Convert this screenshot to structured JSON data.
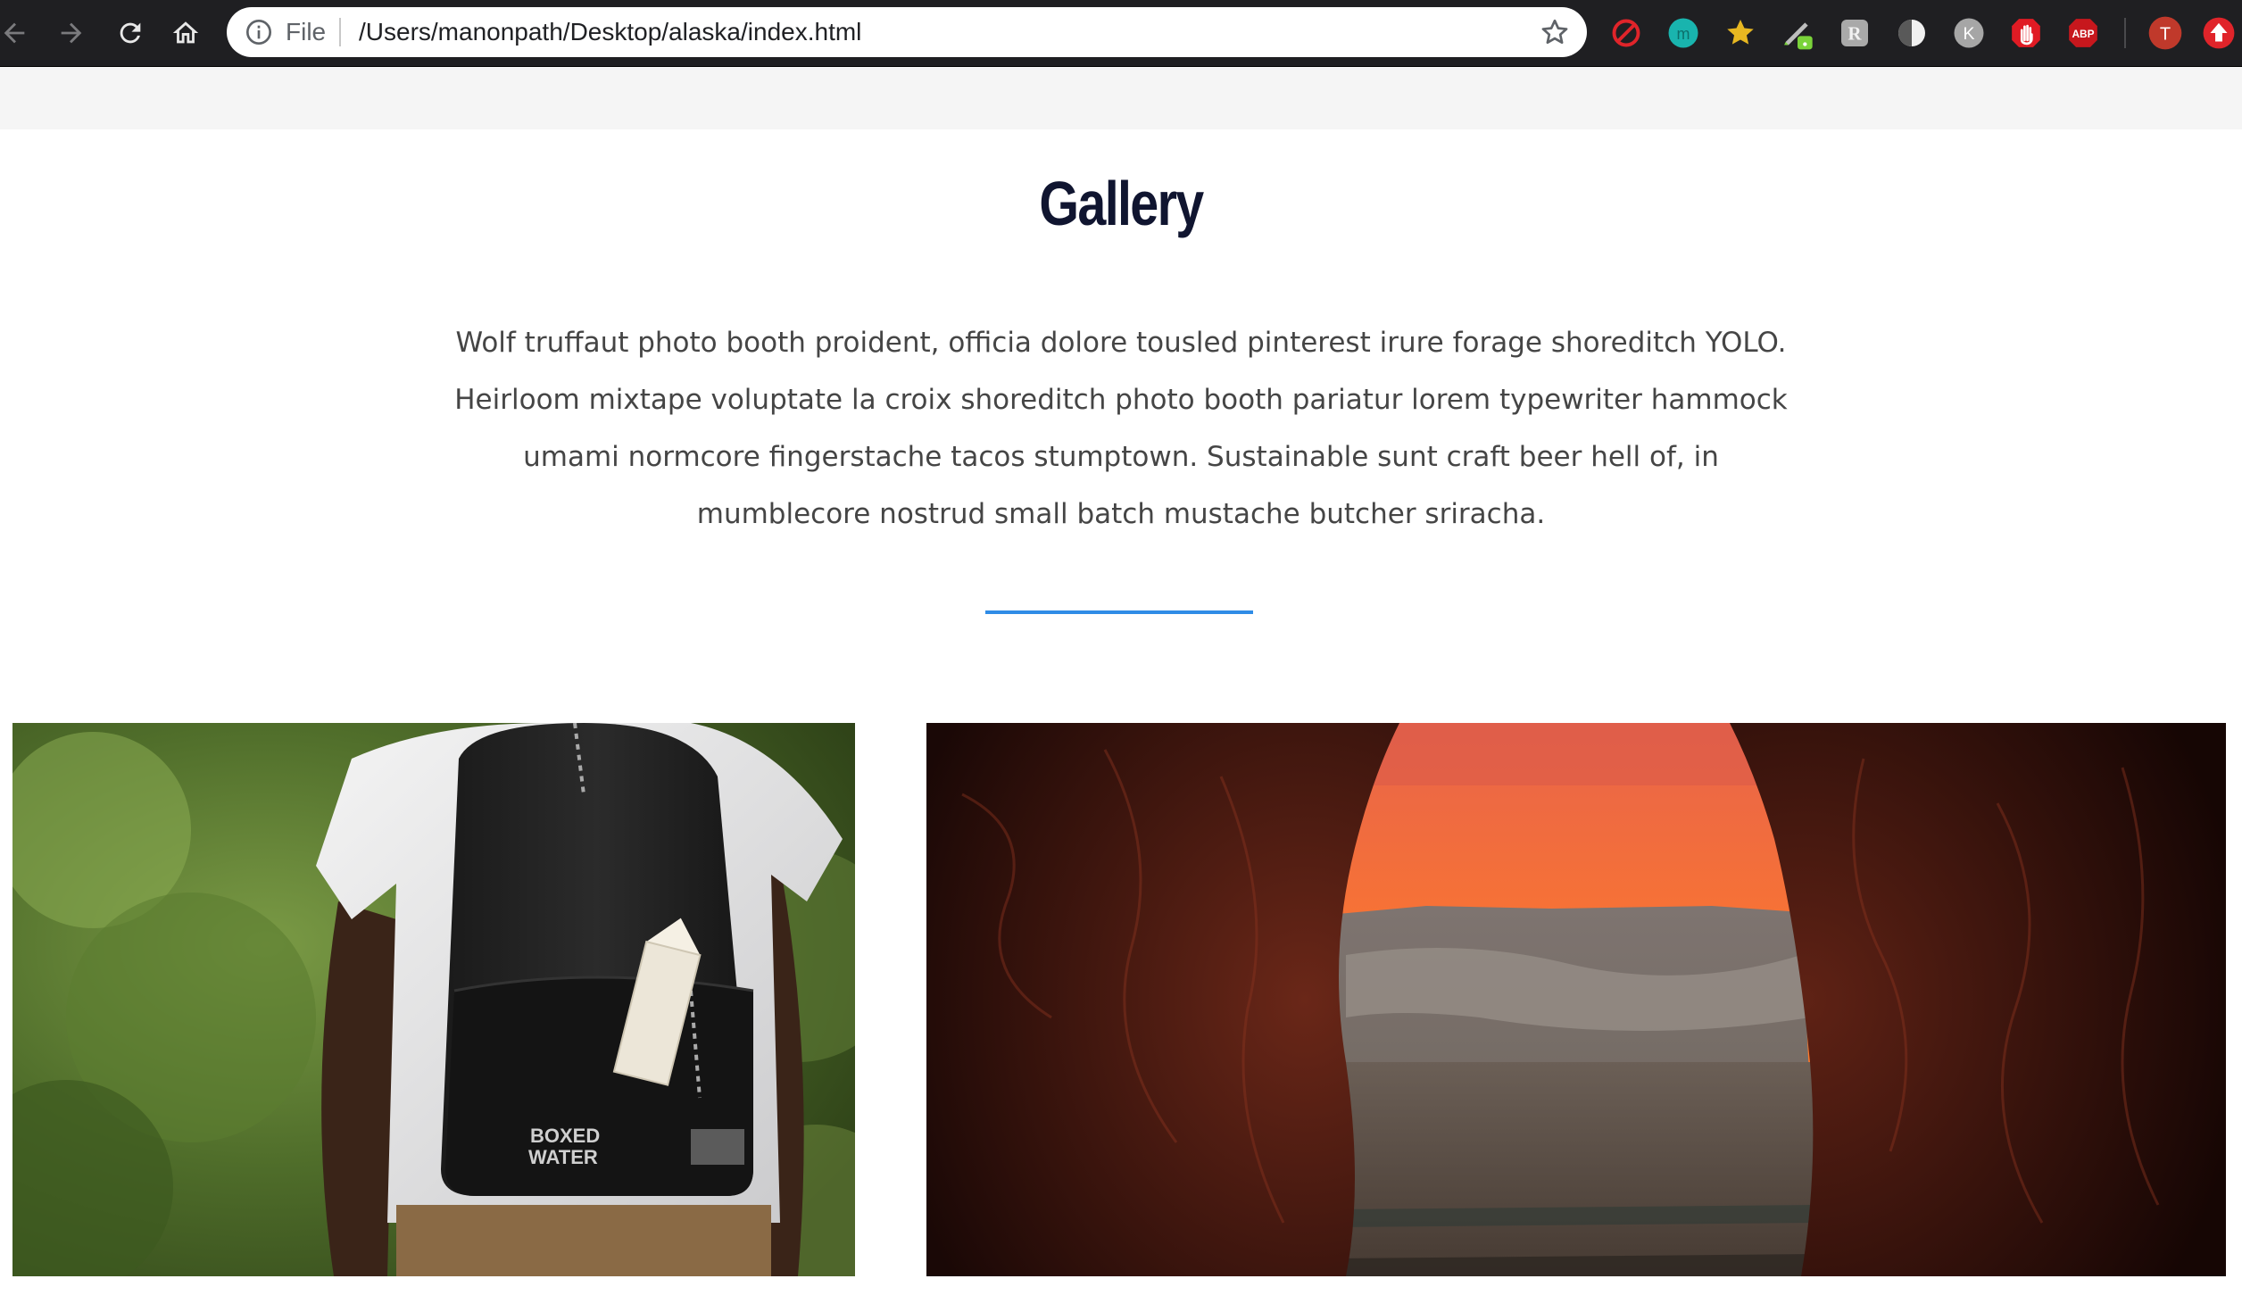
{
  "browser": {
    "omnibox": {
      "scheme_label": "File",
      "url": "/Users/manonpath/Desktop/alaska/index.html"
    },
    "profile_initial": "T",
    "extensions": [
      "no-entry-icon",
      "teal-m-icon",
      "star-badge-icon",
      "pen-icon",
      "r-icon",
      "half-moon-icon",
      "k-icon",
      "hand-stop-icon",
      "adblock-plus-icon",
      "profile-avatar",
      "red-arrow-icon"
    ],
    "extension_labels": {
      "teal_m": "m",
      "r": "R",
      "k": "K",
      "abp": "ABP"
    }
  },
  "gallery": {
    "title": "Gallery",
    "intro": "Wolf truffaut photo booth proident, officia dolore tousled pinterest irure forage shoreditch YOLO. Heirloom mixtape voluptate la croix shoreditch photo booth pariatur lorem typewriter hammock umami normcore fingerstache tacos stumptown. Sustainable sunt craft beer hell of, in mumblecore nostrud small batch mustache butcher sriracha.",
    "accent_color": "#2f8ce6",
    "title_color": "#101530",
    "photos": [
      {
        "subject": "hiker with black backpack and water carton",
        "print_line1": "BOXED",
        "print_line2": "WATER"
      },
      {
        "subject": "sunset canyon view through red rock opening"
      }
    ]
  }
}
